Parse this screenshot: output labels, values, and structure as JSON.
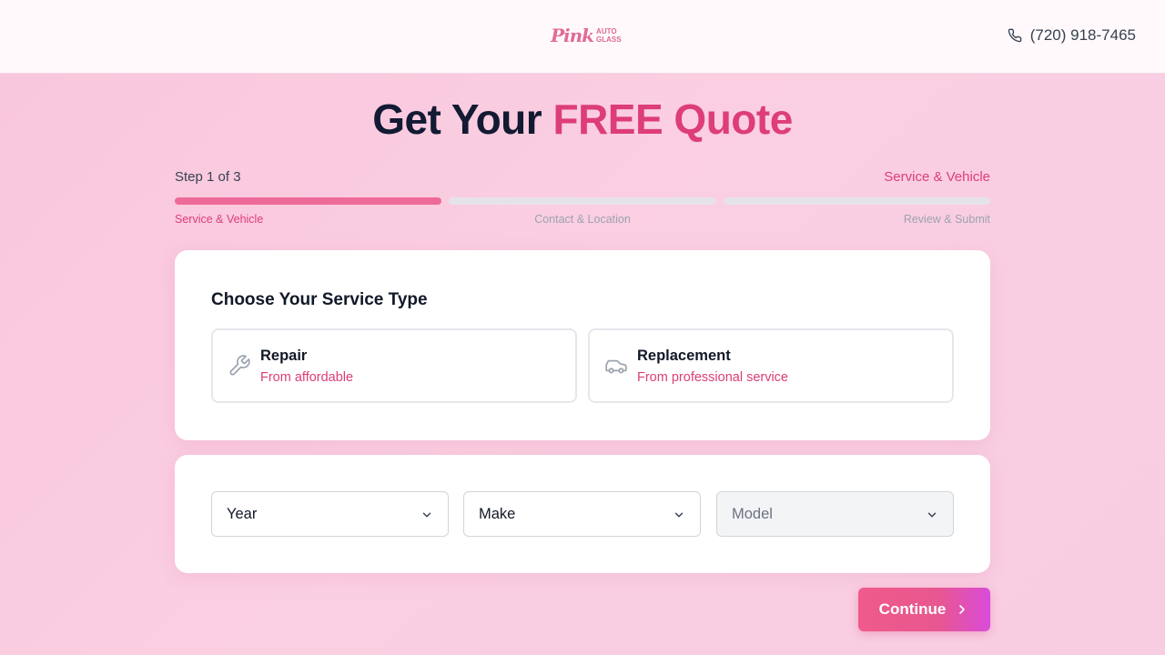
{
  "header": {
    "logo_script": "Pink",
    "logo_line1": "AUTO",
    "logo_line2": "GLASS",
    "phone_icon": "phone-icon",
    "phone": "(720) 918-7465"
  },
  "hero": {
    "title_plain": "Get Your",
    "title_accent": "FREE Quote"
  },
  "progress": {
    "step_label": "Step 1 of 3",
    "current_step": "Service & Vehicle",
    "progress_fraction": 0.333,
    "steps": [
      "Service & Vehicle",
      "Contact & Location",
      "Review & Submit"
    ]
  },
  "service": {
    "title": "Choose Your Service Type",
    "options": [
      {
        "icon": "wrench-icon",
        "title": "Repair",
        "subtitle": "From affordable"
      },
      {
        "icon": "car-icon",
        "title": "Replacement",
        "subtitle": "From professional service"
      }
    ]
  },
  "vehicle": {
    "year": "Year",
    "make": "Make",
    "model": "Model",
    "chevron_icon": "chevron-down-icon"
  },
  "actions": {
    "continue": "Continue",
    "continue_icon": "chevron-right-icon"
  },
  "colors": {
    "accent": "#dd3d78",
    "progress_active": "#ee6a99",
    "progress_inactive": "#e6e3e8",
    "background": "#fbcfe2"
  }
}
